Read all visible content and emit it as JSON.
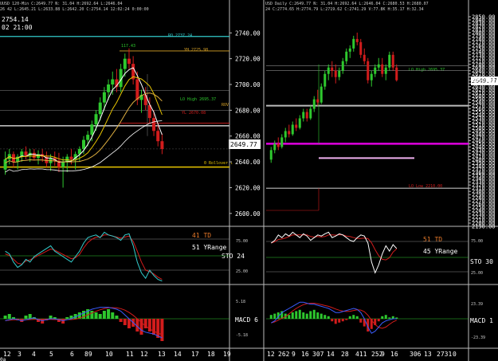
{
  "colors": {
    "bg": "#000000",
    "grid": "#5a5a5a",
    "cyan": "#33cccc",
    "yellow": "#e8c500",
    "orange": "#d7a227",
    "red": "#d21c1c",
    "magenta": "#e000e0",
    "pink": "#f0b0f0",
    "green": "#2ec82e",
    "white": "#ffffff",
    "gray": "#bbbbbb",
    "price_box_bg": "#ffffff",
    "price_box_fg": "#000000",
    "td_orange": "#e87a2a",
    "blue": "#3a5cff"
  },
  "left_panel": {
    "header_line": "UUSD 120-Min  C:2649.77  N: 31.04  H:2692.64  L:2646.04",
    "header_line2": "26 42  L:2645.21  L:2633.88  L:2642.20  C:2754.14  12:02:24  0:00:00",
    "cursor_price": "2754.14",
    "cursor_time": "02 21:00",
    "price_labels": [
      "2740.00",
      "2720.00",
      "2700.00",
      "2680.00",
      "2660.00",
      "2640.00",
      "2620.00",
      "2600.00"
    ],
    "current_price": "2649.77",
    "annotations": {
      "ro": "RO 2737.24",
      "yh": "YH 2725.98",
      "lo_high": "LO High 2695.37",
      "rov": "ROV",
      "yl": "YL 2670.08",
      "rollover": "0 Rollover ↓",
      "peak": "117.43"
    },
    "x_labels": [
      "12",
      "3",
      "4",
      "5",
      "6",
      "89",
      "10",
      "11",
      "12",
      "13",
      "14",
      "17",
      "18",
      "19"
    ],
    "x_prefix": "0a",
    "stoch": {
      "td": "41 TD",
      "yrange": "51 YRange",
      "label": "STO 24",
      "lvl75": "75.00",
      "lvl25": "25.00"
    },
    "macd": {
      "label": "MACD 6",
      "top": "5.18",
      "bot": "-5.18"
    }
  },
  "right_panel": {
    "header_line": "USD Daily  C:2649.77  N: 31.04  H:2692.64  L:2646.04  C:2680.53  H:2680.07",
    "header_line2": "24  C:2774.65  H:2774.79  L:2719.62  C:2741.29  V:77.8K  H:35.17  H:32.34",
    "price_labels": [
      "2850.00",
      "2840.00",
      "2830.00",
      "2820.00",
      "2810.00",
      "2800.00",
      "2790.00",
      "2780.00",
      "2770.00",
      "2760.00",
      "2750.00",
      "2740.00",
      "2730.00",
      "2720.00",
      "2710.00",
      "2700.00",
      "2690.00",
      "2680.00",
      "2670.00",
      "2660.00",
      "2650.00",
      "2640.00",
      "2630.00",
      "2620.00",
      "2610.00",
      "2600.00",
      "2590.00",
      "2580.00",
      "2570.00",
      "2560.00",
      "2550.00",
      "2540.00",
      "2530.00",
      "2520.00",
      "2510.00",
      "2500.00",
      "2490.00",
      "2480.00",
      "2470.00",
      "2460.00",
      "2450.00",
      "2440.00",
      "2430.00",
      "2420.00",
      "2410.00",
      "2400.00",
      "2390.00",
      "2380.00",
      "2370.00",
      "2360.00",
      "2350.00",
      "2340.00",
      "2330.00",
      "2320.00",
      "2310.00",
      "2300.00",
      "2290.00",
      "2280.00",
      "2270.00",
      "2260.00",
      "2250.00",
      "2240.00",
      "2230.00",
      "2220.00",
      "2210.00",
      "2200.00",
      "2190.00"
    ],
    "current_price": "2649.77",
    "annotations": {
      "lo_high": "LO High 2695.37",
      "lo_low": "LO Low 2210.00"
    },
    "x_labels": [
      "12",
      "262",
      "9",
      "16",
      "307",
      "14",
      "28",
      "411",
      "252",
      "9",
      "16",
      "306",
      "13",
      "2731",
      "0"
    ],
    "stoch": {
      "td": "51 TD",
      "yrange": "45 YRange",
      "label": "STO 30",
      "lvl75": "75.00",
      "lvl25": "25.00"
    },
    "macd": {
      "label": "MACD 1",
      "top": "23.39",
      "bot": "-23.39"
    }
  },
  "chart_data": [
    {
      "type": "candlestick",
      "title": "UUSD 120-Min",
      "ylim": [
        2590,
        2755
      ],
      "y_ticks": [
        2740,
        2720,
        2700,
        2680,
        2660,
        2640,
        2620,
        2600
      ],
      "levels": [
        {
          "label": "RO 2737.24",
          "value": 2737.24,
          "color": "cyan"
        },
        {
          "label": "YH 2725.98",
          "value": 2725.98,
          "color": "orange"
        },
        {
          "label": "LO High 2695.37",
          "value": 2695.37,
          "color": "green"
        },
        {
          "label": "YL 2670.08",
          "value": 2670.08,
          "color": "red"
        },
        {
          "label": "0 Rollover",
          "value": 2636,
          "color": "yellow"
        }
      ],
      "ohlc": [
        [
          2634,
          2648,
          2630,
          2642
        ],
        [
          2642,
          2650,
          2638,
          2646
        ],
        [
          2646,
          2648,
          2636,
          2640
        ],
        [
          2640,
          2646,
          2634,
          2644
        ],
        [
          2644,
          2650,
          2640,
          2648
        ],
        [
          2648,
          2652,
          2642,
          2645
        ],
        [
          2645,
          2650,
          2640,
          2647
        ],
        [
          2647,
          2650,
          2641,
          2643
        ],
        [
          2643,
          2649,
          2638,
          2646
        ],
        [
          2646,
          2650,
          2640,
          2644
        ],
        [
          2644,
          2648,
          2636,
          2639
        ],
        [
          2639,
          2646,
          2633,
          2643
        ],
        [
          2643,
          2648,
          2637,
          2641
        ],
        [
          2641,
          2647,
          2632,
          2636
        ],
        [
          2636,
          2644,
          2620,
          2640
        ],
        [
          2640,
          2646,
          2632,
          2644
        ],
        [
          2644,
          2650,
          2638,
          2642
        ],
        [
          2642,
          2648,
          2634,
          2646
        ],
        [
          2646,
          2652,
          2640,
          2650
        ],
        [
          2650,
          2660,
          2646,
          2657
        ],
        [
          2657,
          2664,
          2652,
          2661
        ],
        [
          2661,
          2672,
          2656,
          2669
        ],
        [
          2669,
          2680,
          2664,
          2677
        ],
        [
          2677,
          2690,
          2672,
          2686
        ],
        [
          2686,
          2698,
          2680,
          2694
        ],
        [
          2694,
          2704,
          2688,
          2700
        ],
        [
          2700,
          2710,
          2692,
          2704
        ],
        [
          2704,
          2712,
          2694,
          2698
        ],
        [
          2698,
          2716,
          2694,
          2712
        ],
        [
          2712,
          2724,
          2706,
          2720
        ],
        [
          2720,
          2728,
          2712,
          2716
        ],
        [
          2716,
          2722,
          2700,
          2704
        ],
        [
          2704,
          2710,
          2684,
          2688
        ],
        [
          2688,
          2696,
          2678,
          2692
        ],
        [
          2692,
          2698,
          2680,
          2684
        ],
        [
          2684,
          2690,
          2670,
          2674
        ],
        [
          2674,
          2680,
          2660,
          2664
        ],
        [
          2664,
          2670,
          2652,
          2656
        ],
        [
          2656,
          2662,
          2646,
          2650
        ]
      ]
    },
    {
      "type": "candlestick",
      "title": "USD Daily",
      "ylim": [
        2190,
        2860
      ],
      "ohlc": [
        [
          2400,
          2440,
          2390,
          2430
        ],
        [
          2430,
          2460,
          2420,
          2450
        ],
        [
          2450,
          2470,
          2430,
          2440
        ],
        [
          2440,
          2480,
          2435,
          2470
        ],
        [
          2470,
          2500,
          2455,
          2490
        ],
        [
          2490,
          2510,
          2470,
          2480
        ],
        [
          2480,
          2520,
          2475,
          2510
        ],
        [
          2510,
          2530,
          2490,
          2500
        ],
        [
          2500,
          2540,
          2495,
          2530
        ],
        [
          2530,
          2560,
          2520,
          2550
        ],
        [
          2550,
          2560,
          2520,
          2530
        ],
        [
          2530,
          2570,
          2525,
          2560
        ],
        [
          2560,
          2600,
          2550,
          2590
        ],
        [
          2590,
          2620,
          2570,
          2580
        ],
        [
          2580,
          2640,
          2575,
          2630
        ],
        [
          2630,
          2680,
          2620,
          2670
        ],
        [
          2670,
          2700,
          2650,
          2690
        ],
        [
          2690,
          2710,
          2660,
          2680
        ],
        [
          2680,
          2700,
          2640,
          2660
        ],
        [
          2660,
          2690,
          2650,
          2680
        ],
        [
          2680,
          2720,
          2670,
          2710
        ],
        [
          2710,
          2750,
          2700,
          2740
        ],
        [
          2740,
          2760,
          2720,
          2750
        ],
        [
          2750,
          2790,
          2740,
          2780
        ],
        [
          2780,
          2800,
          2760,
          2770
        ],
        [
          2770,
          2780,
          2720,
          2730
        ],
        [
          2730,
          2750,
          2700,
          2710
        ],
        [
          2710,
          2720,
          2640,
          2650
        ],
        [
          2650,
          2680,
          2630,
          2670
        ],
        [
          2670,
          2700,
          2660,
          2690
        ],
        [
          2690,
          2720,
          2680,
          2700
        ],
        [
          2700,
          2720,
          2660,
          2670
        ],
        [
          2670,
          2700,
          2650,
          2690
        ],
        [
          2690,
          2740,
          2680,
          2730
        ],
        [
          2730,
          2740,
          2680,
          2690
        ],
        [
          2690,
          2700,
          2646,
          2650
        ]
      ]
    }
  ]
}
